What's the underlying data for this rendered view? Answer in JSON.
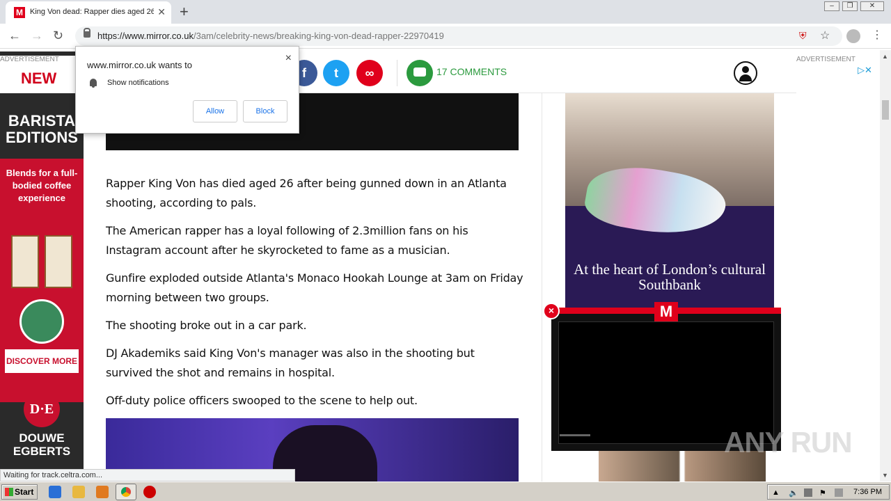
{
  "browser": {
    "tab_title": "King Von dead: Rapper dies aged 26",
    "tab_favicon": "M",
    "new_tab": "+",
    "url_host": "https://www.mirror.co.uk",
    "url_path": "/3am/celebrity-news/breaking-king-von-dead-rapper-22970419",
    "status": "Waiting for track.celtra.com..."
  },
  "notification": {
    "title": "www.mirror.co.uk wants to",
    "text": "Show notifications",
    "allow": "Allow",
    "block": "Block",
    "close": "×"
  },
  "ads": {
    "label": "ADVERTISEMENT",
    "left": {
      "new": "NEW",
      "headline": "BARISTA EDITIONS",
      "tagline": "Blends for a full-bodied coffee experience",
      "cta": "DISCOVER MORE",
      "brand_logo": "D·E",
      "brand": "DOUWE EGBERTS"
    },
    "right": {
      "headline": "At the heart of London’s cultural Southbank"
    }
  },
  "social": {
    "facebook": "f",
    "twitter": "t",
    "link": "∞",
    "comments_label": "17 COMMENTS"
  },
  "article": {
    "paragraphs": [
      "Rapper King Von has died aged 26 after being gunned down in an Atlanta shooting, according to pals.",
      "The American rapper has a loyal following of 2.3million fans on his Instagram account after he skyrocketed to fame as a musician.",
      "Gunfire exploded outside Atlanta's Monaco Hookah Lounge at 3am on Friday morning between two groups.",
      "The shooting broke out in a car park.",
      "DJ Akademiks said King Von's manager was also in the shooting but survived the shot and remains in hospital.",
      "Off-duty police officers swooped to the scene to help out."
    ]
  },
  "player": {
    "logo": "M",
    "close": "×"
  },
  "taskbar": {
    "start": "Start",
    "clock": "7:36 PM"
  },
  "watermark": "ANY RUN",
  "colors": {
    "mirror_red": "#e0001b",
    "comments_green": "#2b9a3e",
    "twitter_blue": "#1da1f2",
    "facebook_blue": "#3b5998"
  }
}
